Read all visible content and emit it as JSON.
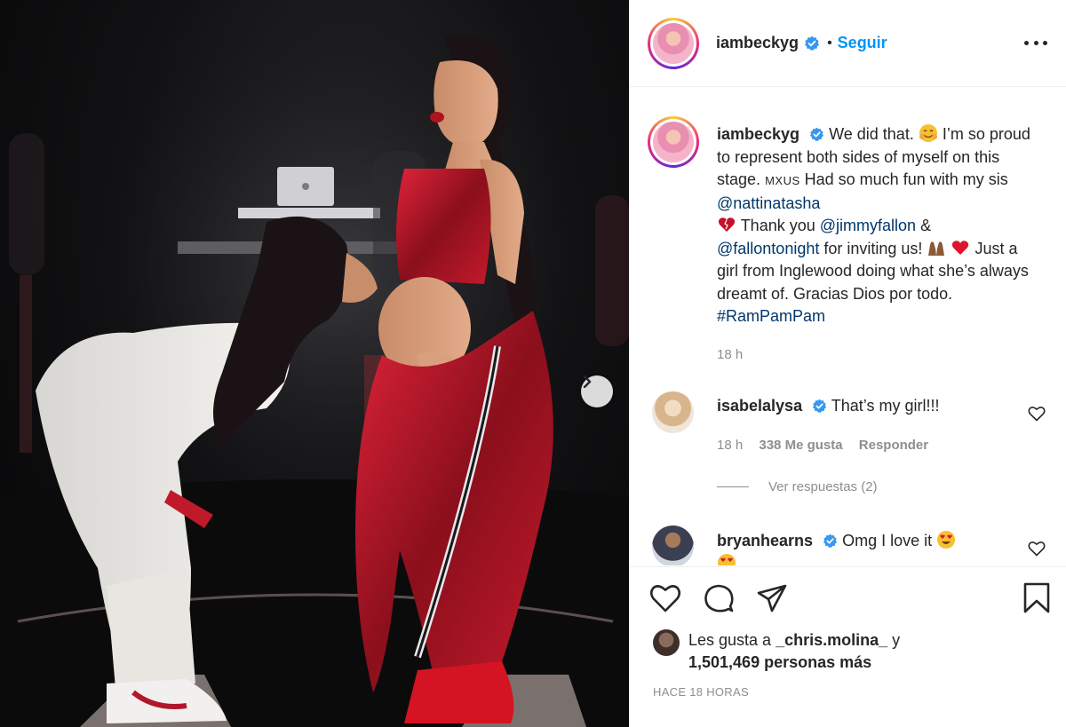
{
  "post": {
    "author": "iambeckyg",
    "follow_label": "Seguir",
    "separator": "•",
    "caption": {
      "author": "iambeckyg",
      "part1": "We did that.",
      "part2": "I’m so proud to represent both sides of myself on this stage.",
      "flags": "MXUS",
      "part3": "Had so much fun with my sis",
      "mention1": "@nattinatasha",
      "part4": "Thank you",
      "mention2": "@jimmyfallon",
      "amp": "&",
      "mention3": "@fallontonight",
      "part5": "for inviting us!",
      "part6": "Just a girl from Inglewood doing what she’s always dreamt of. Gracias Dios por todo.",
      "hashtag": "#RamPamPam",
      "time": "18 h"
    }
  },
  "comments": [
    {
      "user": "isabelalysa",
      "text": "That’s my girl!!!",
      "time": "18 h",
      "likes": "338 Me gusta",
      "reply": "Responder",
      "view_replies": "Ver respuestas (2)"
    },
    {
      "user": "bryanhearns",
      "text": "Omg I love it"
    }
  ],
  "footer": {
    "likes_line1_prefix": "Les gusta a",
    "likes_user": "_chris.molina_",
    "likes_line1_suffix": "y",
    "likes_line2": "1,501,469 personas más",
    "timestamp": "HACE 18 HORAS"
  },
  "colors": {
    "link": "#00376b",
    "follow": "#0095f6",
    "verified": "#3897f0",
    "muted": "#8e8e8e",
    "heart": "#ed4956"
  },
  "icons": [
    "chevron-right-icon",
    "verified-icon",
    "more-icon",
    "heart-icon",
    "comment-icon",
    "share-icon",
    "bookmark-icon"
  ]
}
